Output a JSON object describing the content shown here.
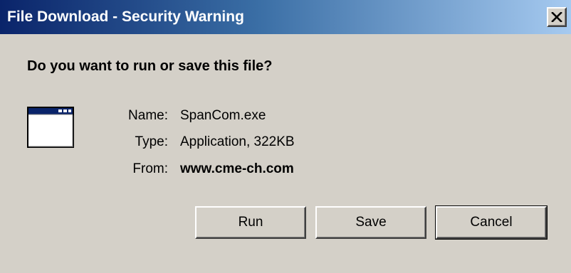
{
  "window": {
    "title": "File Download - Security Warning"
  },
  "dialog": {
    "question": "Do you want to run or save this file?",
    "fields": [
      {
        "label": "Name:",
        "value": "SpanCom.exe"
      },
      {
        "label": "Type:",
        "value": "Application, 322KB"
      },
      {
        "label": "From:",
        "value": "www.cme-ch.com"
      }
    ]
  },
  "buttons": {
    "run": "Run",
    "save": "Save",
    "cancel": "Cancel"
  },
  "icons": {
    "close": "close-icon",
    "file": "application-window-icon"
  },
  "colors": {
    "titlebar_start": "#0a246a",
    "titlebar_end": "#a6caf0",
    "face": "#d4d0c8"
  }
}
